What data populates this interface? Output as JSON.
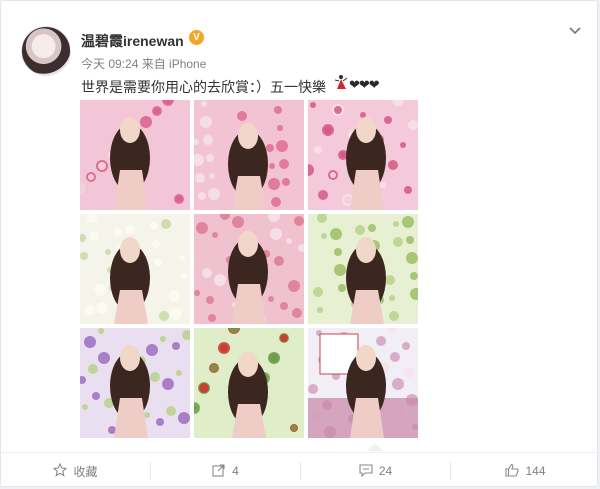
{
  "post": {
    "username": "温碧霞irenewan",
    "verified_label": "V",
    "meta": "今天 09:24 来自 iPhone",
    "text": "世界是需要你用心的去欣賞：）五一快樂",
    "hearts": "❤❤❤",
    "menu_icon": "chevron-down-icon"
  },
  "actions": {
    "favorite": {
      "label": "收藏",
      "icon": "star-icon"
    },
    "repost": {
      "count": "4",
      "icon": "share-icon"
    },
    "comment": {
      "count": "24",
      "icon": "comment-icon"
    },
    "like": {
      "count": "144",
      "icon": "thumbs-up-icon"
    }
  },
  "photos": [
    {
      "theme": "pink-flowers",
      "sky": "#f3c6d7",
      "accent": "#d95e8b"
    },
    {
      "theme": "pink-flowers",
      "sky": "#f2c3d3",
      "accent": "#e06d93"
    },
    {
      "theme": "pink-flowers",
      "sky": "#f4c9d9",
      "accent": "#d45886"
    },
    {
      "theme": "white-flowers",
      "sky": "#f4f4ea",
      "accent": "#c75a7f"
    },
    {
      "theme": "pink-flowers",
      "sky": "#f0c2cf",
      "accent": "#dd7a95"
    },
    {
      "theme": "wisteria",
      "sky": "#e7f0d2",
      "accent": "#9bbf66"
    },
    {
      "theme": "wisteria",
      "sky": "#eadff0",
      "accent": "#9b6fc2"
    },
    {
      "theme": "roses",
      "sky": "#dfeec9",
      "accent": "#d2312c"
    },
    {
      "theme": "sign",
      "sky": "#f1eef5",
      "accent": "#d2a1c0"
    }
  ],
  "colors": {
    "text": "#333333",
    "muted": "#808080",
    "verified": "#f5a623"
  }
}
